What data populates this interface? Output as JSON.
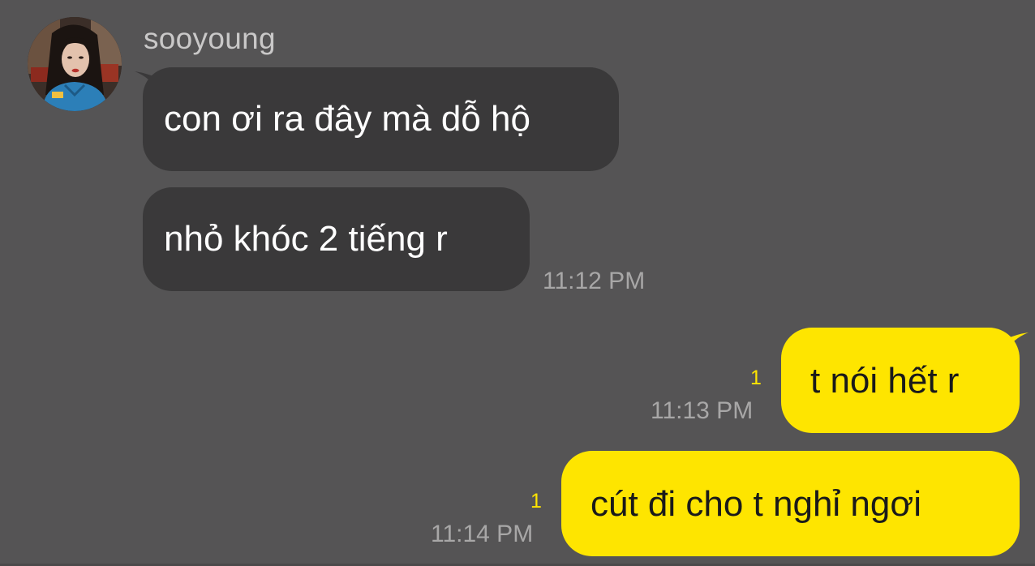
{
  "conversation": {
    "sender_name": "sooyoung",
    "messages": [
      {
        "from": "sooyoung",
        "text": "con ơi ra đây mà dỗ hộ"
      },
      {
        "from": "sooyoung",
        "text": "nhỏ khóc 2 tiếng r",
        "time": "11:12 PM"
      },
      {
        "from": "me",
        "text": "t nói hết r",
        "time": "11:13 PM",
        "unread": "1"
      },
      {
        "from": "me",
        "text": "cút đi cho t nghỉ ngơi",
        "time": "11:14 PM",
        "unread": "1"
      }
    ]
  },
  "colors": {
    "background": "#555455",
    "incoming_bubble": "#3a393a",
    "outgoing_bubble": "#fee500",
    "unread_count": "#fee500"
  },
  "icons": {
    "avatar": "profile-photo"
  }
}
